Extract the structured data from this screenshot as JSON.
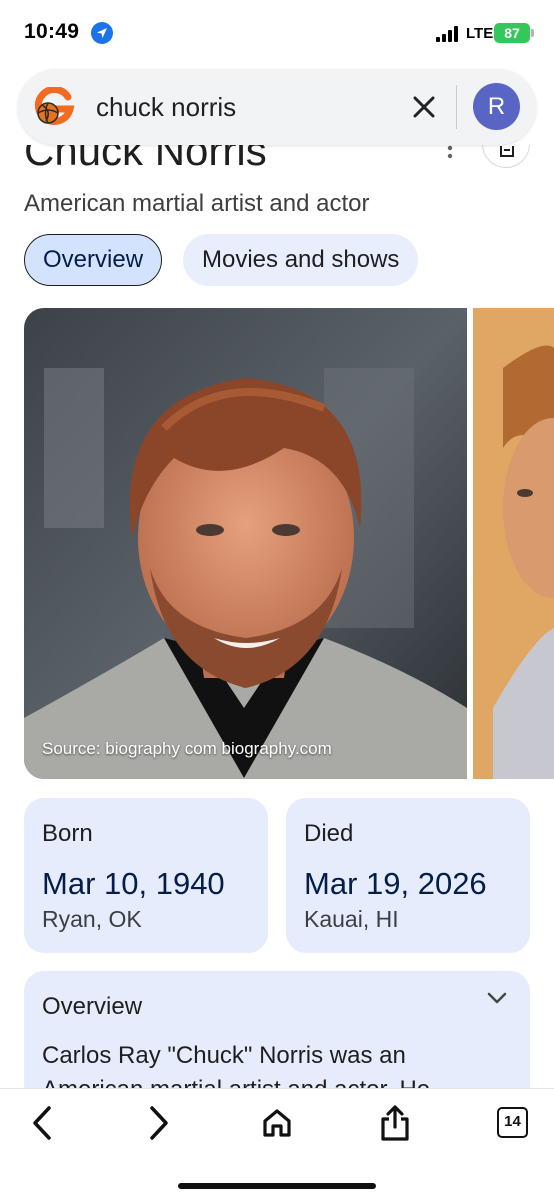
{
  "status_bar": {
    "time": "10:49",
    "network": "LTE",
    "battery": "87"
  },
  "search": {
    "query": "chuck norris",
    "avatar_letter": "R"
  },
  "entity": {
    "title": "Chuck Norris",
    "subtitle": "American martial artist and actor"
  },
  "tabs": [
    {
      "label": "Overview",
      "selected": true
    },
    {
      "label": "Movies and shows",
      "selected": false
    }
  ],
  "images": {
    "source_caption": "Source: biography com biography.com"
  },
  "facts": {
    "born": {
      "label": "Born",
      "date": "Mar 10, 1940",
      "place": "Ryan, OK"
    },
    "died": {
      "label": "Died",
      "date": "Mar 19, 2026",
      "place": "Kauai, HI"
    }
  },
  "overview": {
    "heading": "Overview",
    "text": "Carlos Ray \"Chuck\" Norris was an American martial artist and actor. He"
  },
  "toolbar": {
    "tab_count": "14"
  },
  "colors": {
    "accent": "#1a73e8",
    "chip_selected": "#d3e3fd",
    "card_bg": "#e6ecfb",
    "avatar_bg": "#5865c5",
    "battery": "#34c759"
  },
  "icons": [
    "location-arrow-icon",
    "signal-bars-icon",
    "battery-icon",
    "google-logo-icon",
    "close-icon",
    "more-vert-icon",
    "save-icon",
    "chevron-down-icon",
    "back-icon",
    "forward-icon",
    "home-icon",
    "share-icon"
  ]
}
